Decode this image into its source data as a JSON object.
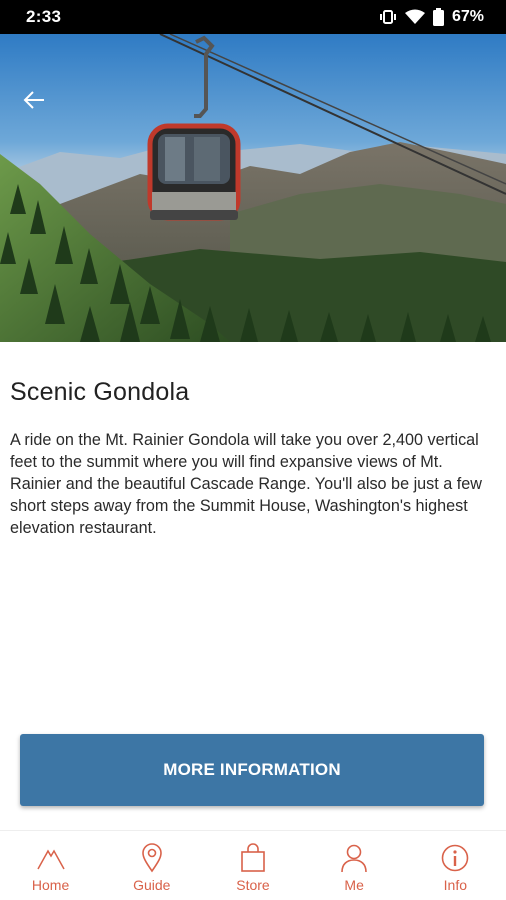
{
  "status_bar": {
    "time": "2:33",
    "battery": "67%",
    "icons": [
      "vibrate-icon",
      "wifi-icon",
      "battery-icon"
    ]
  },
  "hero": {
    "image_description": "gondola-cable-car-over-mountains",
    "back_icon": "arrow-left-icon"
  },
  "main": {
    "title": "Scenic Gondola",
    "description": "A ride on the Mt. Rainier Gondola will take you over 2,400 vertical feet to the summit where you will find expansive views of Mt. Rainier and the beautiful Cascade Range. You'll also be just a few short steps away from the Summit House, Washington's highest elevation restaurant.",
    "button_label": "MORE INFORMATION"
  },
  "nav": {
    "items": [
      {
        "label": "Home",
        "icon": "mountain-icon"
      },
      {
        "label": "Guide",
        "icon": "map-pin-icon"
      },
      {
        "label": "Store",
        "icon": "shopping-bag-icon"
      },
      {
        "label": "Me",
        "icon": "person-icon"
      },
      {
        "label": "Info",
        "icon": "info-icon"
      }
    ]
  },
  "colors": {
    "accent": "#d9624a",
    "button": "#3d76a5"
  }
}
